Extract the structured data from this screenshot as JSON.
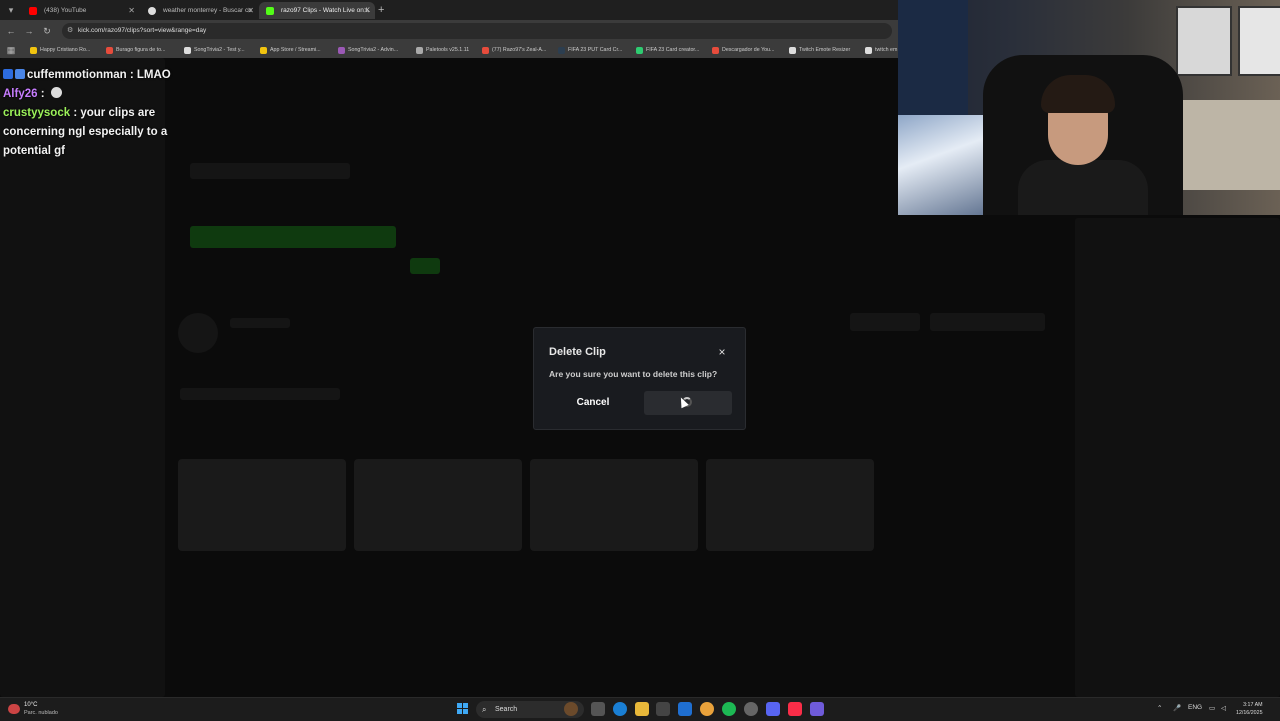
{
  "browser": {
    "tabs": [
      {
        "label": "(438) YouTube",
        "favicon_color": "#ff0000"
      },
      {
        "label": "weather monterrey - Buscar co",
        "favicon_color": "#dddddd"
      },
      {
        "label": "razo97 Clips - Watch Live on K",
        "favicon_color": "#53fc18"
      }
    ],
    "new_tab": "+",
    "url": "kick.com/razo97/clips?sort=view&range=day",
    "bookmarks": [
      {
        "label": "Happy Cristiano Ro...",
        "color": "#f1c40f"
      },
      {
        "label": "Burago figura de to...",
        "color": "#e74c3c"
      },
      {
        "label": "SongTrivia2 - Test y...",
        "color": "#dddddd"
      },
      {
        "label": "App Store / Streami...",
        "color": "#f1c40f"
      },
      {
        "label": "SongTrivia2 - Advin...",
        "color": "#9b59b6"
      },
      {
        "label": "Paletools v25.1.11",
        "color": "#aaaaaa"
      },
      {
        "label": "(77) Razo97's Zeal-A...",
        "color": "#e74c3c"
      },
      {
        "label": "FIFA 23 PUT Card Cr...",
        "color": "#2c3e50"
      },
      {
        "label": "FIFA 23 Card creator...",
        "color": "#2ecc71"
      },
      {
        "label": "Descargador de You...",
        "color": "#e74c3c"
      },
      {
        "label": "Twitch Emote Resizer",
        "color": "#dddddd"
      },
      {
        "label": "twitch em",
        "color": "#dddddd"
      }
    ]
  },
  "chat": [
    {
      "user": "cuffemmotionman",
      "message": " : LMAO",
      "color": "#f2f2f2"
    },
    {
      "user": "Alfy26",
      "message": " : ",
      "color": "#c77dff"
    },
    {
      "user": "crustyysock",
      "message": " : your clips are concerning ngl especially to a potential gf",
      "color": "#9cf25a"
    }
  ],
  "dialog": {
    "title": "Delete Clip",
    "message": "Are you sure you want to delete this clip?",
    "cancel_label": "Cancel",
    "close_icon": "×",
    "confirm_state": "loading"
  },
  "taskbar": {
    "weather_temp": "10°C",
    "weather_desc": "Parc. nublado",
    "search_label": "Search",
    "lang": "ENG",
    "time": "3:17 AM",
    "date": "12/16/2025"
  }
}
